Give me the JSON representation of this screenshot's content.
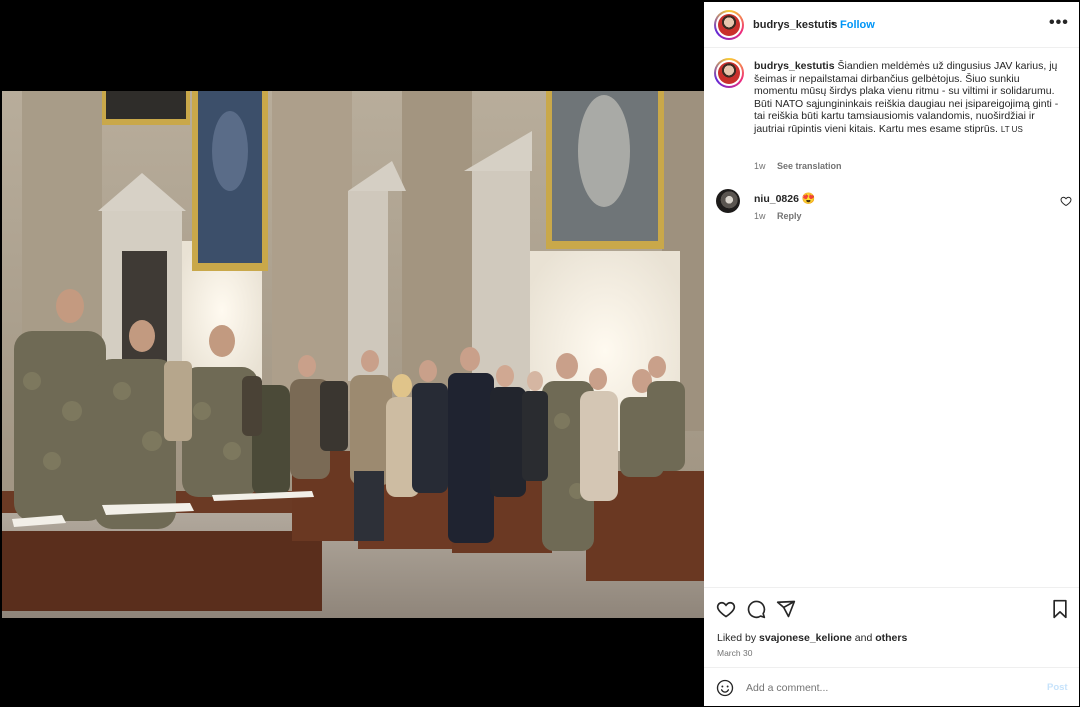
{
  "post": {
    "author": "budrys_kestutis",
    "separator": "•",
    "follow_label": "Follow",
    "more_icon": "more-horizontal-icon",
    "more_glyph": "•••"
  },
  "caption": {
    "author": "budrys_kestutis",
    "text": "Šiandien meldėmės už dingusius JAV karius, jų šeimas ir nepailstamai dirbančius gelbėtojus. Šiuo sunkiu momentu mūsų širdys plaka vienu ritmu - su viltimi ir solidarumu.",
    "text2": "Būti NATO sąjungininkais reiškia daugiau nei įsipareigojimą ginti - tai reiškia būti kartu tamsiausiomis valandomis, nuoširdžiai ir jautriai rūpintis vieni kitais. Kartu mes esame stiprūs.",
    "flag": "LT US",
    "time": "1w",
    "translate_label": "See translation"
  },
  "comments": [
    {
      "author": "niu_0826",
      "text": "😍",
      "time": "1w",
      "reply_label": "Reply"
    }
  ],
  "actions": {
    "like_icon": "heart-icon",
    "comment_icon": "comment-icon",
    "share_icon": "share-icon",
    "save_icon": "bookmark-icon"
  },
  "likes": {
    "prefix": "Liked by",
    "user": "svajonese_kelione",
    "and": "and",
    "others": "others"
  },
  "date": "March 30",
  "add_comment": {
    "placeholder": "Add a comment...",
    "post_label": "Post",
    "emoji_icon": "emoji-icon"
  },
  "colors": {
    "accent": "#0095f6",
    "text": "#262626",
    "muted": "#737373",
    "post_disabled": "#c7e3fb",
    "background": "#000000"
  }
}
